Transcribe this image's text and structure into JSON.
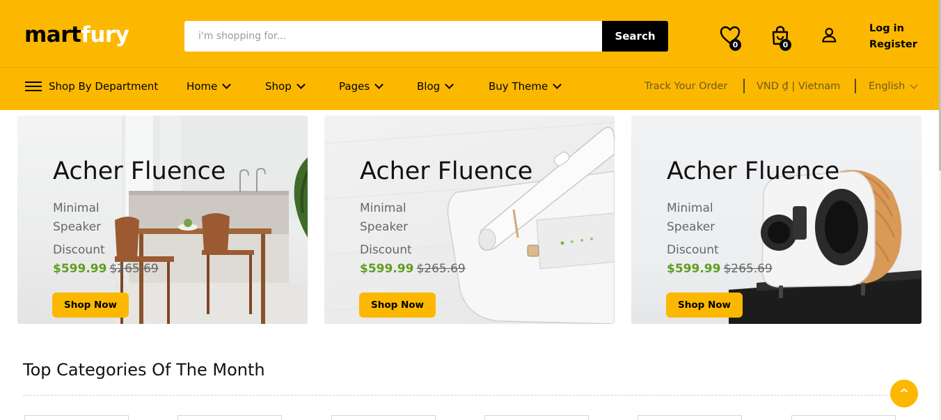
{
  "brand": {
    "logo_part1": "mart",
    "logo_part2": "fury"
  },
  "search": {
    "placeholder": "i'm shopping for...",
    "button_label": "Search"
  },
  "header_icons": [
    {
      "name": "heart-icon",
      "badge": "0"
    },
    {
      "name": "shopping-bag-icon",
      "badge": "0"
    },
    {
      "name": "user-icon"
    }
  ],
  "auth": {
    "login": "Log in",
    "register": "Register"
  },
  "nav": {
    "department": "Shop By Department",
    "items": [
      {
        "label": "Home"
      },
      {
        "label": "Shop"
      },
      {
        "label": "Pages"
      },
      {
        "label": "Blog"
      },
      {
        "label": "Buy Theme"
      }
    ],
    "track_order": "Track Your Order",
    "currency": "VND ₫ | Vietnam",
    "language": "English"
  },
  "promos": [
    {
      "title": "Acher Fluence",
      "subtitle": "Minimal Speaker",
      "discount": "Discount",
      "price": "$599.99",
      "old_price": "$265.69",
      "button": "Shop Now"
    },
    {
      "title": "Acher Fluence",
      "subtitle": "Minimal Speaker",
      "discount": "Discount",
      "price": "$599.99",
      "old_price": "$265.69",
      "button": "Shop Now"
    },
    {
      "title": "Acher Fluence",
      "subtitle": "Minimal Speaker",
      "discount": "Discount",
      "price": "$599.99",
      "old_price": "$265.69",
      "button": "Shop Now"
    }
  ],
  "categories": {
    "title": "Top Categories Of The Month"
  },
  "back_to_top": "^",
  "colors": {
    "primary": "#fcb800",
    "price_green": "#5f9e1e",
    "text_dark": "#000000"
  }
}
